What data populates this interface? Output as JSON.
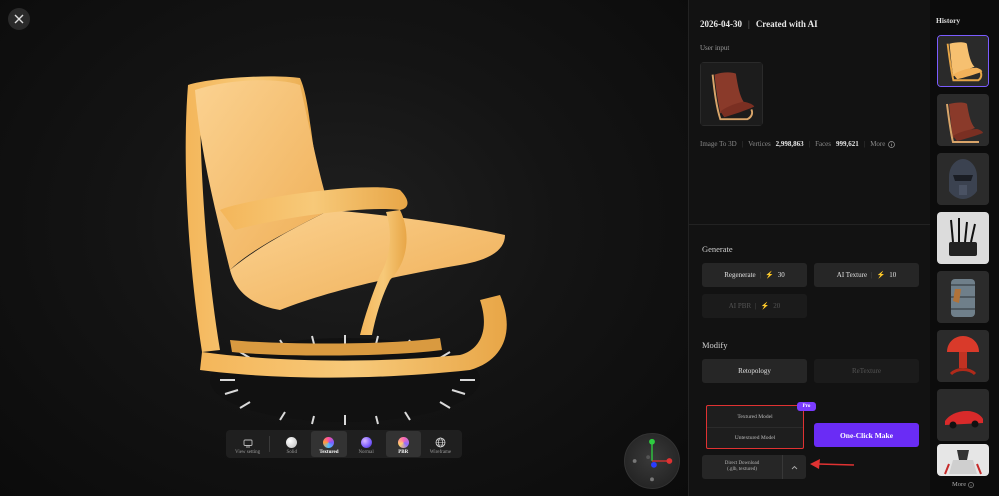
{
  "viewport": {
    "toolbar": [
      {
        "label": "View setting",
        "icon": "monitor-icon"
      },
      {
        "label": "Solid",
        "icon": "white-sphere-icon"
      },
      {
        "label": "Textured",
        "icon": "textured-sphere-icon"
      },
      {
        "label": "Normal",
        "icon": "normal-sphere-icon"
      },
      {
        "label": "PBR",
        "icon": "pbr-sphere-icon"
      },
      {
        "label": "Wireframe",
        "icon": "wireframe-globe-icon"
      }
    ],
    "active_mode": "Textured"
  },
  "panel": {
    "date": "2026-04-30",
    "created_with": "Created with AI",
    "user_input_label": "User input",
    "stats": {
      "mode": "Image To 3D",
      "vertices_label": "Vertices",
      "vertices_value": "2,998,863",
      "faces_label": "Faces",
      "faces_value": "999,621",
      "more_label": "More"
    },
    "generate": {
      "title": "Generate",
      "regenerate": {
        "label": "Regenerate",
        "cost": "30"
      },
      "ai_texture": {
        "label": "AI Texture",
        "cost": "10"
      },
      "ai_pbr": {
        "label": "AI PBR",
        "cost": "20"
      }
    },
    "modify": {
      "title": "Modify",
      "retopology": "Retopology",
      "retexture": "ReTexture"
    },
    "download_menu": {
      "options": [
        "Textured Model",
        "Untextured Model"
      ],
      "pro_badge": "Pro"
    },
    "one_click_make": "One-Click Make",
    "direct_download": {
      "line1": "Direct Download",
      "line2": "(.glb, textured)"
    }
  },
  "history": {
    "title": "History",
    "more_label": "More",
    "items": [
      {
        "name": "yellow-chair",
        "selected": true
      },
      {
        "name": "brown-chair",
        "selected": false
      },
      {
        "name": "helmet",
        "selected": false
      },
      {
        "name": "pen-holder",
        "selected": false
      },
      {
        "name": "barrel",
        "selected": false
      },
      {
        "name": "red-mushroom",
        "selected": false
      },
      {
        "name": "red-sports-car",
        "selected": false
      },
      {
        "name": "robot-figure",
        "selected": false
      }
    ]
  },
  "colors": {
    "accent": "#6a2cf5",
    "highlight": "#e03232",
    "bolt": "#f5c341"
  }
}
